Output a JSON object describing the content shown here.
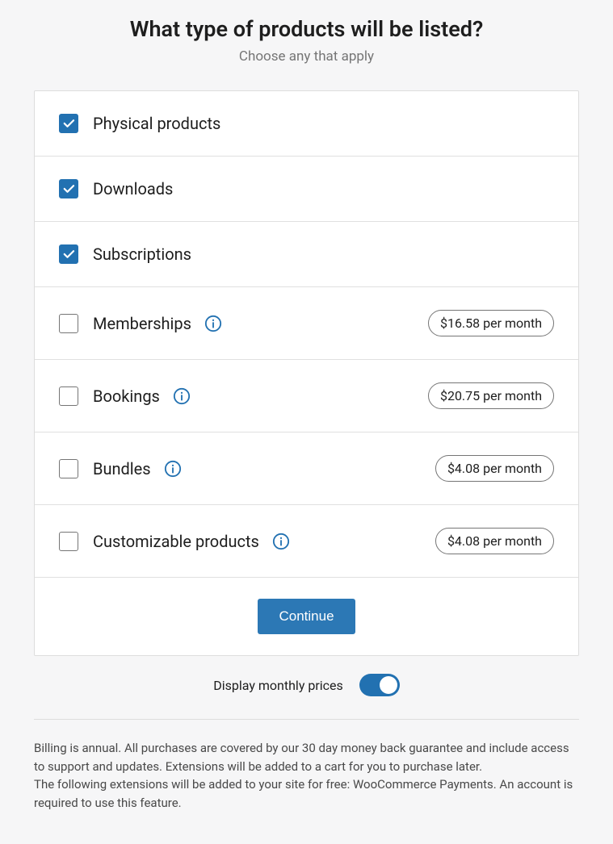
{
  "heading": "What type of products will be listed?",
  "subheading": "Choose any that apply",
  "options": [
    {
      "label": "Physical products",
      "checked": true,
      "info": false,
      "price": null
    },
    {
      "label": "Downloads",
      "checked": true,
      "info": false,
      "price": null
    },
    {
      "label": "Subscriptions",
      "checked": true,
      "info": false,
      "price": null
    },
    {
      "label": "Memberships",
      "checked": false,
      "info": true,
      "price": "$16.58 per month"
    },
    {
      "label": "Bookings",
      "checked": false,
      "info": true,
      "price": "$20.75 per month"
    },
    {
      "label": "Bundles",
      "checked": false,
      "info": true,
      "price": "$4.08 per month"
    },
    {
      "label": "Customizable products",
      "checked": false,
      "info": true,
      "price": "$4.08 per month"
    }
  ],
  "continue_label": "Continue",
  "toggle_label": "Display monthly prices",
  "toggle_on": true,
  "footer_text_1": "Billing is annual. All purchases are covered by our 30 day money back guarantee and include access to support and updates. Extensions will be added to a cart for you to purchase later.",
  "footer_text_2": "The following extensions will be added to your site for free: WooCommerce Payments. An account is required to use this feature."
}
